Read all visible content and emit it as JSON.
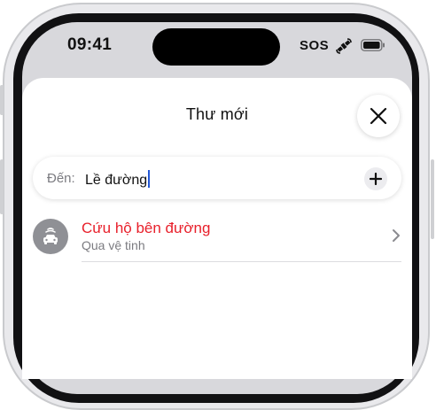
{
  "status_bar": {
    "time": "09:41",
    "sos_label": "SOS",
    "icons": [
      "satellite-icon",
      "battery-icon"
    ]
  },
  "header": {
    "title": "Thư mới",
    "close_icon": "close-icon"
  },
  "to_field": {
    "label": "Đến:",
    "value": "Lề đường",
    "add_icon": "plus-icon"
  },
  "suggestion": {
    "title": "Cứu hộ bên đường",
    "subtitle": "Qua vệ tinh",
    "icon": "roadside-car-icon",
    "title_color": "#e8202b"
  }
}
